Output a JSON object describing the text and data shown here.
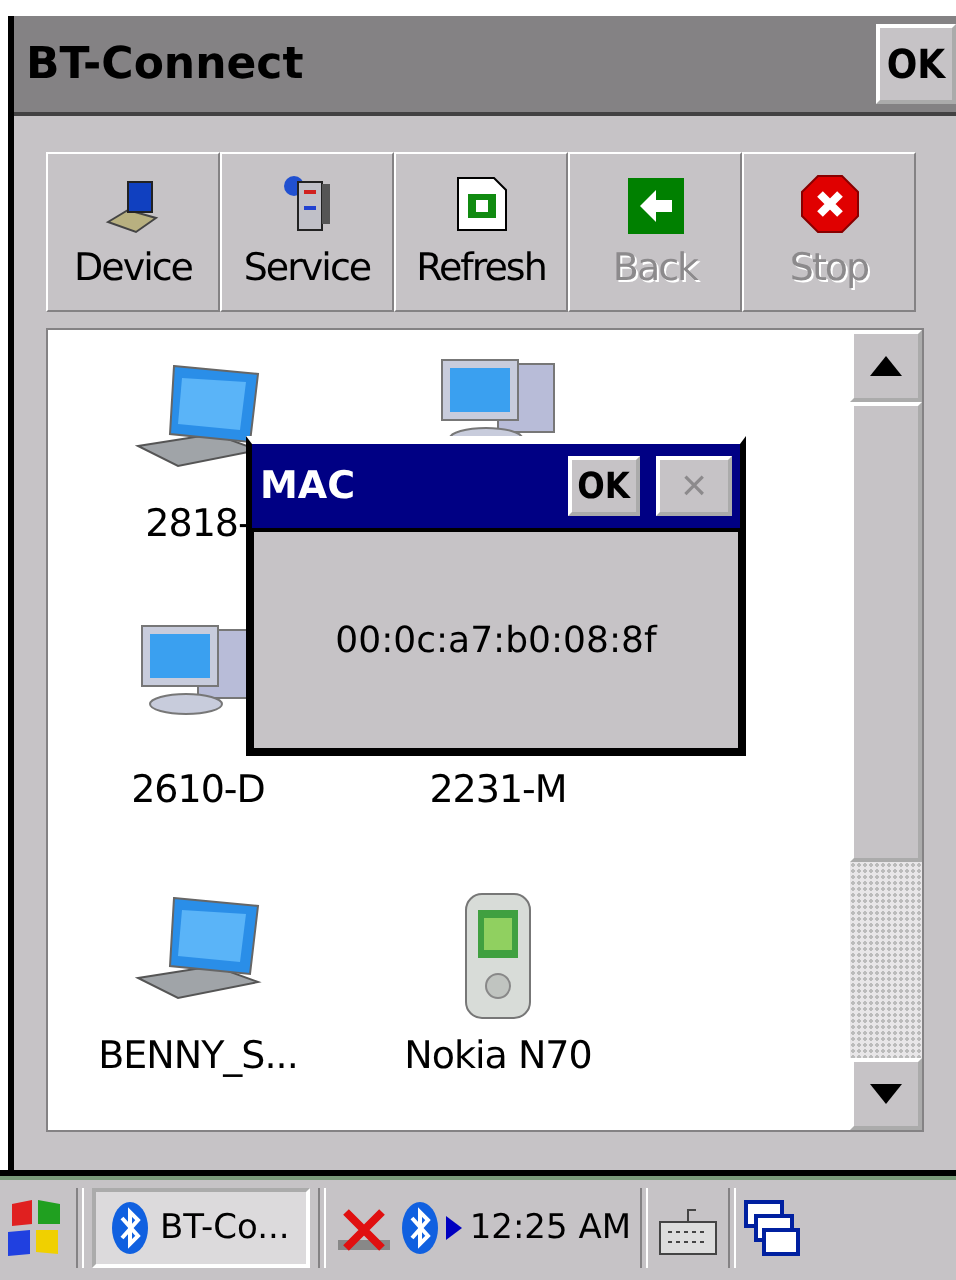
{
  "window": {
    "title": "BT-Connect",
    "ok_button": "OK"
  },
  "toolbar": [
    {
      "label": "Device",
      "kind": "device",
      "disabled": false
    },
    {
      "label": "Service",
      "kind": "service",
      "disabled": false
    },
    {
      "label": "Refresh",
      "kind": "refresh",
      "disabled": false
    },
    {
      "label": "Back",
      "kind": "back",
      "disabled": true
    },
    {
      "label": "Stop",
      "kind": "stop",
      "disabled": true
    }
  ],
  "devices": [
    {
      "kind": "laptop",
      "name": "2818-"
    },
    {
      "kind": "desktop"
    },
    {
      "kind": "desktop",
      "name": "2610-D"
    },
    {
      "name": "2231-M"
    },
    {
      "kind": "laptop",
      "name": "BENNY_S..."
    },
    {
      "kind": "phone",
      "name": "Nokia N70"
    }
  ],
  "dialog": {
    "title": "MAC",
    "ok_button": "OK",
    "close_button": "×",
    "close_disabled": true,
    "message": "00:0c:a7:b0:08:8f"
  },
  "taskbar": {
    "task": "BT-Co...",
    "time": "12:25 AM"
  }
}
